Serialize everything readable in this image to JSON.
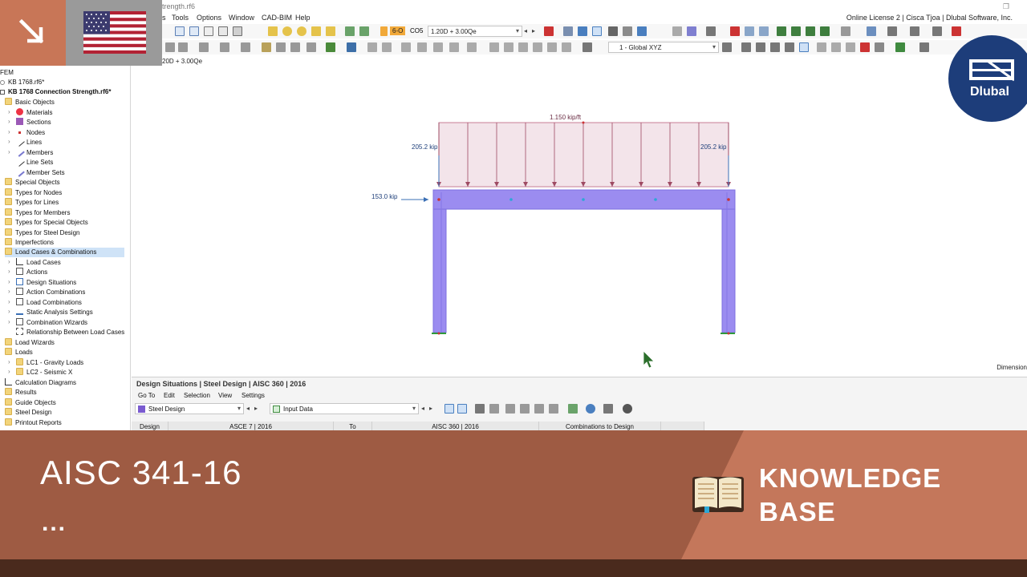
{
  "window": {
    "file_title": "trength.rf6",
    "license": "Online License 2 | Cisca Tjoa | Dlubal Software, Inc."
  },
  "menu": [
    "s",
    "Tools",
    "Options",
    "Window",
    "CAD-BIM",
    "Help"
  ],
  "toolbar": {
    "lc_tag": "6-O",
    "lc_code": "CO5",
    "lc_combo": "1.20D + 3.00Qe",
    "coord_system": "1 - Global XYZ"
  },
  "view_label": "20D + 3.00Qe",
  "navigator": {
    "root": "FEM",
    "items": [
      {
        "label": "KB 1768.rf6*",
        "bold": false
      },
      {
        "label": "KB 1768 Connection Strength.rf6*",
        "bold": true
      },
      {
        "label": "Basic Objects"
      },
      {
        "label": "Materials"
      },
      {
        "label": "Sections"
      },
      {
        "label": "Nodes"
      },
      {
        "label": "Lines"
      },
      {
        "label": "Members"
      },
      {
        "label": "Line Sets"
      },
      {
        "label": "Member Sets"
      },
      {
        "label": "Special Objects"
      },
      {
        "label": "Types for Nodes"
      },
      {
        "label": "Types for Lines"
      },
      {
        "label": "Types for Members"
      },
      {
        "label": "Types for Special Objects"
      },
      {
        "label": "Types for Steel Design"
      },
      {
        "label": "Imperfections"
      },
      {
        "label": "Load Cases & Combinations"
      },
      {
        "label": "Load Cases"
      },
      {
        "label": "Actions"
      },
      {
        "label": "Design Situations"
      },
      {
        "label": "Action Combinations"
      },
      {
        "label": "Load Combinations"
      },
      {
        "label": "Static Analysis Settings"
      },
      {
        "label": "Combination Wizards"
      },
      {
        "label": "Relationship Between Load Cases"
      },
      {
        "label": "Load Wizards"
      },
      {
        "label": "Loads"
      },
      {
        "label": "LC1 - Gravity Loads"
      },
      {
        "label": "LC2 - Seismic X"
      },
      {
        "label": "Calculation Diagrams"
      },
      {
        "label": "Results"
      },
      {
        "label": "Guide Objects"
      },
      {
        "label": "Steel Design"
      },
      {
        "label": "Printout Reports"
      }
    ]
  },
  "model": {
    "distributed_load": "1.150 kip/ft",
    "left_reaction": "205.2 kip",
    "right_reaction": "205.2 kip",
    "lateral_load": "153.0 kip",
    "dimension_label": "Dimension"
  },
  "panel": {
    "title": "Design Situations | Steel Design | AISC 360 | 2016",
    "menu": [
      "Go To",
      "Edit",
      "Selection",
      "View",
      "Settings"
    ],
    "module_combo": "Steel Design",
    "table_combo": "Input Data",
    "columns": [
      "Design",
      "ASCE 7 | 2016",
      "To",
      "AISC 360 | 2016",
      "Combinations to Design"
    ]
  },
  "logo": "Dlubal",
  "banner": {
    "title": "AISC 341-16",
    "subtitle": "...",
    "kb_line1": "KNOWLEDGE",
    "kb_line2": "BASE"
  },
  "colors": {
    "banner_dark": "#9e5b43",
    "banner_light": "#c4775b",
    "footer": "#4a2a1d",
    "member": "#9b8cf0",
    "load_fill": "#f3e4ea",
    "dlubal_blue": "#1d3d7a"
  }
}
